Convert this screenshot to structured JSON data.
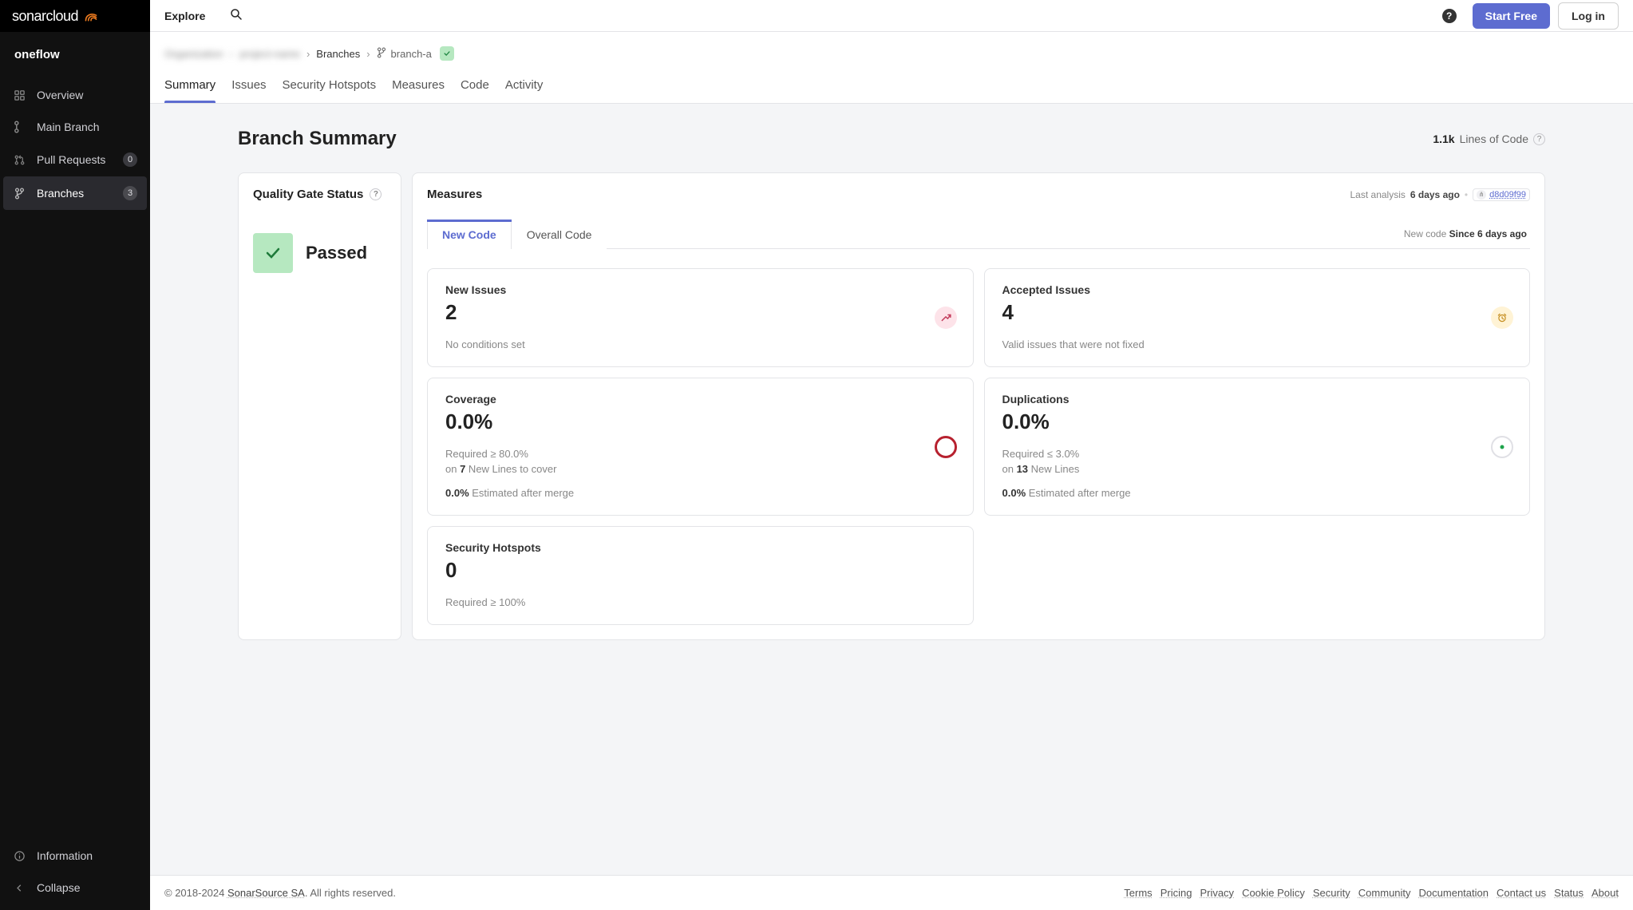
{
  "topbar": {
    "brand": "sonarcloud",
    "explore": "Explore",
    "start_free": "Start Free",
    "login": "Log in"
  },
  "sidebar": {
    "org": "oneflow",
    "items": [
      {
        "label": "Overview",
        "icon": "grid-icon",
        "active": false,
        "interact": true,
        "badge": null
      },
      {
        "label": "Main Branch",
        "icon": "branch-icon",
        "active": false,
        "interact": true,
        "badge": null
      },
      {
        "label": "Pull Requests",
        "icon": "pr-icon",
        "active": false,
        "interact": true,
        "badge": "0"
      },
      {
        "label": "Branches",
        "icon": "branches-icon",
        "active": true,
        "interact": true,
        "badge": "3"
      }
    ],
    "information": "Information",
    "collapse": "Collapse"
  },
  "breadcrumb": {
    "blurred1": "Organization",
    "blurred2": "project-name",
    "branches": "Branches",
    "branch": "branch-a"
  },
  "tabs": [
    "Summary",
    "Issues",
    "Security Hotspots",
    "Measures",
    "Code",
    "Activity"
  ],
  "page_title": "Branch Summary",
  "loc": {
    "value": "1.1k",
    "label": "Lines of Code"
  },
  "quality_gate": {
    "title": "Quality Gate Status",
    "status": "Passed"
  },
  "measures": {
    "title": "Measures",
    "last_analysis_label": "Last analysis",
    "last_analysis_time": "6 days ago",
    "commit": "d8d09f99",
    "subtabs": [
      "New Code",
      "Overall Code"
    ],
    "new_code_since_label": "New code",
    "new_code_since_value": "Since 6 days ago",
    "cards": {
      "new_issues": {
        "title": "New Issues",
        "value": "2",
        "sub": "No conditions set"
      },
      "accepted": {
        "title": "Accepted Issues",
        "value": "4",
        "sub": "Valid issues that were not fixed"
      },
      "coverage": {
        "title": "Coverage",
        "value": "0.0%",
        "req": "Required ≥ 80.0%",
        "on_label": "on ",
        "on_bold": "7",
        "on_rest": " New Lines to cover",
        "est_bold": "0.0%",
        "est_rest": " Estimated after merge"
      },
      "dup": {
        "title": "Duplications",
        "value": "0.0%",
        "req": "Required ≤ 3.0%",
        "on_label": "on ",
        "on_bold": "13",
        "on_rest": " New Lines",
        "est_bold": "0.0%",
        "est_rest": " Estimated after merge"
      },
      "hotspots": {
        "title": "Security Hotspots",
        "value": "0",
        "req": "Required ≥ 100%"
      }
    }
  },
  "footer": {
    "copyright_pre": "© 2018-2024 ",
    "company": "SonarSource SA",
    "copyright_post": ". All rights reserved.",
    "links": [
      "Terms",
      "Pricing",
      "Privacy",
      "Cookie Policy",
      "Security",
      "Community",
      "Documentation",
      "Contact us",
      "Status",
      "About"
    ]
  }
}
